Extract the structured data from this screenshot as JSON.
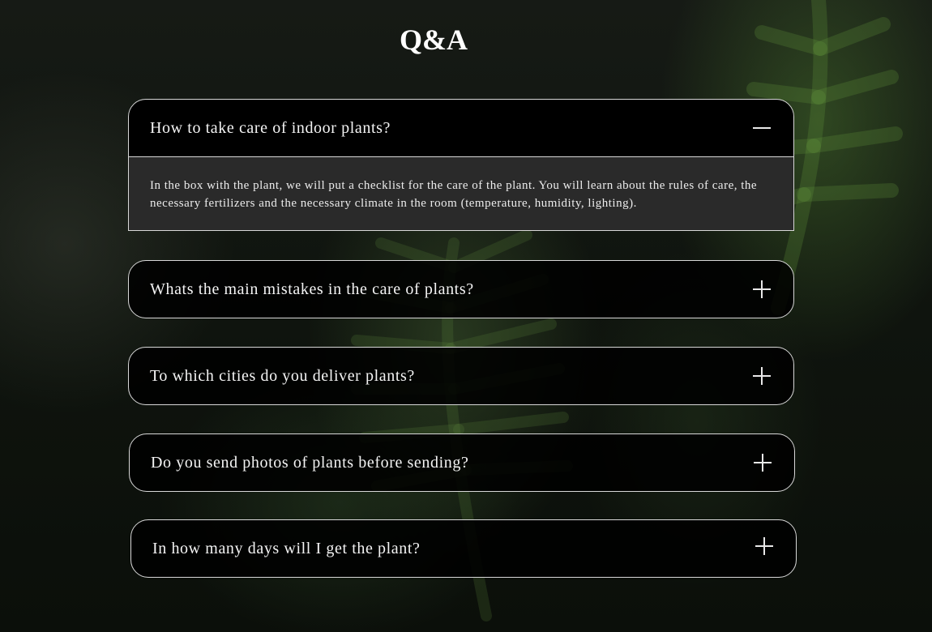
{
  "page": {
    "title": "Q&A"
  },
  "faq": [
    {
      "question": "How to take care of indoor plants?",
      "answer": "In the box with the plant, we will put a checklist for the care of the plant. You will learn about the rules of care, the necessary fertilizers and the necessary climate in the room (temperature, humidity, lighting).",
      "expanded": true,
      "toggle_icon": "minus-icon"
    },
    {
      "question": "Whats the main mistakes in the care of plants?",
      "expanded": false,
      "toggle_icon": "plus-icon"
    },
    {
      "question": "To which cities do you deliver plants?",
      "expanded": false,
      "toggle_icon": "plus-icon"
    },
    {
      "question": "Do you send photos of plants before sending?",
      "expanded": false,
      "toggle_icon": "plus-icon"
    },
    {
      "question": "In how many days will I get the plant?",
      "expanded": false,
      "toggle_icon": "plus-icon"
    }
  ]
}
